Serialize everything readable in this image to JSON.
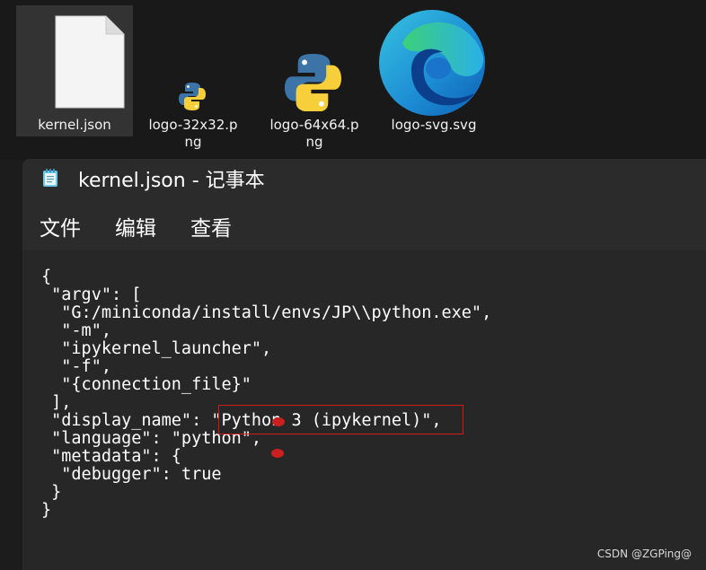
{
  "desktop": {
    "files": [
      {
        "name": "kernel.json",
        "selected": true,
        "icon": "text-file-icon"
      },
      {
        "name": "logo-32x32.png",
        "selected": false,
        "icon": "python-logo-icon"
      },
      {
        "name": "logo-64x64.png",
        "selected": false,
        "icon": "python-logo-icon"
      },
      {
        "name": "logo-svg.svg",
        "selected": false,
        "icon": "edge-browser-icon"
      }
    ]
  },
  "notepad": {
    "title": "kernel.json - 记事本",
    "app_icon": "notepad-icon",
    "menu": [
      "文件",
      "编辑",
      "查看"
    ],
    "content_lines": [
      "{",
      " \"argv\": [",
      "  \"G:/miniconda/install/envs/JP\\\\python.exe\",",
      "  \"-m\",",
      "  \"ipykernel_launcher\",",
      "  \"-f\",",
      "  \"{connection_file}\"",
      " ],",
      " \"display_name\": \"Python 3 (ipykernel)\",",
      " \"language\": \"python\",",
      " \"metadata\": {",
      "  \"debugger\": true",
      " }",
      "}"
    ]
  },
  "watermark": "CSDN @ZGPing@",
  "colors": {
    "highlight": "#d11b1b",
    "background": "#272727"
  }
}
